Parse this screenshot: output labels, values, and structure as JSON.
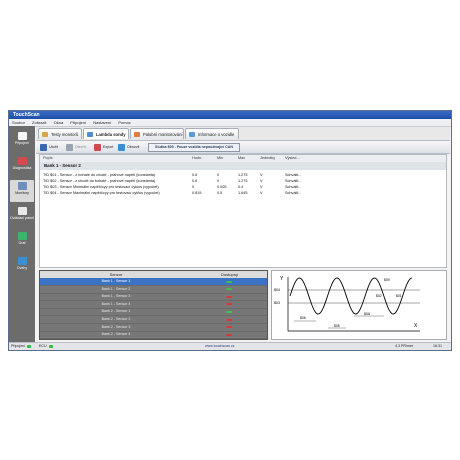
{
  "window": {
    "title": "TouchScan"
  },
  "menu": [
    "Soubor",
    "Zobrazit",
    "Okna",
    "Připojení",
    "Nastavení",
    "Pomoc"
  ],
  "sidebar": [
    {
      "label": "Připojení",
      "icon": "plug-icon",
      "color": "#f5f5f5"
    },
    {
      "label": "Diagnostika",
      "icon": "wrench-icon",
      "color": "#d44b4b"
    },
    {
      "label": "Monitory",
      "icon": "gauge-icon",
      "color": "#6f8fbf",
      "active": true
    },
    {
      "label": "Ovládací panel",
      "icon": "car-icon",
      "color": "#e9e9e9"
    },
    {
      "label": "Graf",
      "icon": "chart-icon",
      "color": "#3cb56b"
    },
    {
      "label": "Ovahy",
      "icon": "scale-icon",
      "color": "#3d8ed1"
    }
  ],
  "tabs": [
    {
      "label": "Testy monitorů",
      "color": "#d9a441"
    },
    {
      "label": "Lambda sondy",
      "color": "#4f8fd1",
      "active": true
    },
    {
      "label": "Palubní monitorování",
      "color": "#e07b39"
    },
    {
      "label": "Informace o vozidle",
      "color": "#5a9bd6"
    }
  ],
  "toolbar": {
    "buttons": [
      {
        "label": "Uložit",
        "color": "#3a67b1"
      },
      {
        "label": "Otevřít",
        "color": "#9aa3b1"
      },
      {
        "label": "Export",
        "color": "#d04b4b"
      },
      {
        "label": "Obnovit",
        "color": "#3c8fd2"
      }
    ],
    "info": "Služba $05 - Pouze vozidla nepoužívající CAN"
  },
  "grid": {
    "columns": [
      "Popis",
      "Hodn.",
      "Min",
      "Max",
      "Jednotky",
      "Výsled..."
    ],
    "group": "Bank 1 - Sensor 2",
    "rows": [
      [
        "TID $01 - Sensor - z bohaté do chudé - prahové napětí (konstanta)",
        "0.6",
        "0",
        "1.275",
        "V",
        "Schválit..."
      ],
      [
        "TID $02 - Sensor - z chudé do bohaté - prahové napětí (konstanta)",
        "0.6",
        "0",
        "1.275",
        "V",
        "Schválit..."
      ],
      [
        "TID $03 - Sensor Minimální napětí/cyy pro testovací cyklus (vypočet)",
        "0",
        "0.005",
        "0.4",
        "V",
        "Schválit..."
      ],
      [
        "TID $04 - Sensor Maximální napětí/cyy pro testovací cyklus (vypočet)",
        "0.815",
        "0.5",
        "1.645",
        "V",
        "Schválit..."
      ]
    ]
  },
  "sensors": {
    "columns": [
      "Senzor",
      "Dostupný"
    ],
    "rows": [
      {
        "name": "Bank 1 - Sensor 1",
        "available": true,
        "selected": true
      },
      {
        "name": "Bank 1 - Sensor 2",
        "available": true
      },
      {
        "name": "Bank 1 - Sensor 3",
        "available": false
      },
      {
        "name": "Bank 1 - Sensor 4",
        "available": false
      },
      {
        "name": "Bank 2 - Sensor 1",
        "available": true
      },
      {
        "name": "Bank 2 - Sensor 2",
        "available": false
      },
      {
        "name": "Bank 2 - Sensor 3",
        "available": false
      },
      {
        "name": "Bank 2 - Sensor 4",
        "available": false
      }
    ],
    "colors": {
      "yes": "#3fbf4a",
      "no": "#d23a3a"
    }
  },
  "diagram": {
    "y_axis": "Y",
    "x_axis": "X",
    "labels": [
      "$04",
      "$03",
      "$06",
      "$05",
      "$0A",
      "$01",
      "$02",
      "$09"
    ]
  },
  "status": {
    "connection": "Připojení",
    "ecu": "ECU",
    "url": "www.touchscan.cz",
    "memory": "4.3 PR/mer",
    "time": "16:31"
  }
}
